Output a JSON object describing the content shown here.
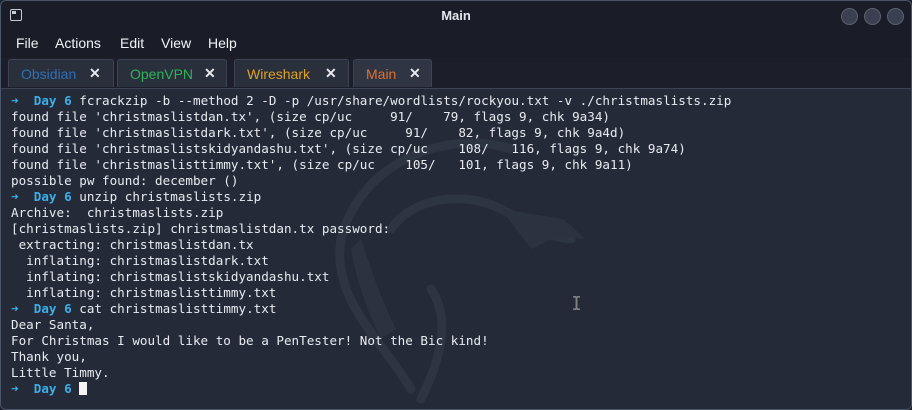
{
  "window": {
    "title": "Main"
  },
  "menu": {
    "items": [
      "File",
      "Actions",
      "Edit",
      "View",
      "Help"
    ]
  },
  "tabs": [
    {
      "label": "Obsidian",
      "color": "#2f6fb7"
    },
    {
      "label": "OpenVPN",
      "color": "#2fb35a"
    },
    {
      "label": "Wireshark",
      "color": "#e0a020"
    },
    {
      "label": "Main",
      "color": "#e07030",
      "active": true
    }
  ],
  "terminal": {
    "prompt_arrow": "➜",
    "prompt_dir": "Day 6",
    "lines": [
      {
        "type": "prompt",
        "cmd": "fcrackzip -b --method 2 -D -p /usr/share/wordlists/rockyou.txt -v ./christmaslists.zip"
      },
      {
        "type": "out",
        "text": "found file 'christmaslistdan.tx', (size cp/uc     91/    79, flags 9, chk 9a34)"
      },
      {
        "type": "out",
        "text": "found file 'christmaslistdark.txt', (size cp/uc     91/    82, flags 9, chk 9a4d)"
      },
      {
        "type": "out",
        "text": "found file 'christmaslistskidyandashu.txt', (size cp/uc    108/   116, flags 9, chk 9a74)"
      },
      {
        "type": "out",
        "text": "found file 'christmaslisttimmy.txt', (size cp/uc    105/   101, flags 9, chk 9a11)"
      },
      {
        "type": "out",
        "text": "possible pw found: december ()"
      },
      {
        "type": "prompt",
        "cmd": "unzip christmaslists.zip"
      },
      {
        "type": "out",
        "text": "Archive:  christmaslists.zip"
      },
      {
        "type": "out",
        "text": "[christmaslists.zip] christmaslistdan.tx password:"
      },
      {
        "type": "out",
        "text": " extracting: christmaslistdan.tx"
      },
      {
        "type": "out",
        "text": "  inflating: christmaslistdark.txt"
      },
      {
        "type": "out",
        "text": "  inflating: christmaslistskidyandashu.txt"
      },
      {
        "type": "out",
        "text": "  inflating: christmaslisttimmy.txt"
      },
      {
        "type": "prompt",
        "cmd": "cat christmaslisttimmy.txt"
      },
      {
        "type": "out",
        "text": "Dear Santa,"
      },
      {
        "type": "out",
        "text": "For Christmas I would like to be a PenTester! Not the Bic kind!"
      },
      {
        "type": "out",
        "text": "Thank you,"
      },
      {
        "type": "out",
        "text": "Little Timmy."
      },
      {
        "type": "prompt",
        "cmd": ""
      }
    ]
  }
}
